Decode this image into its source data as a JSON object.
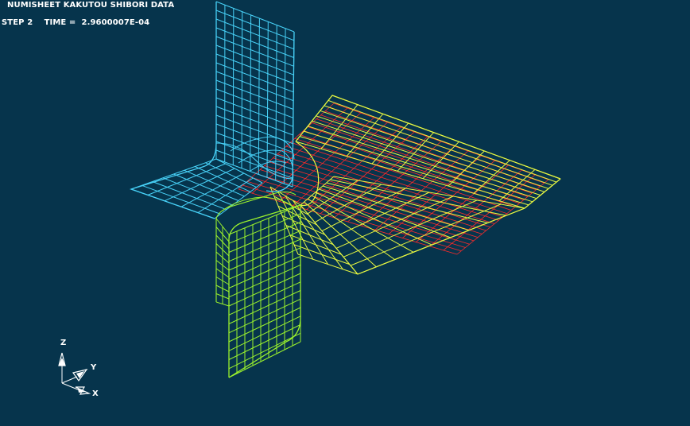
{
  "viewer": {
    "title": "NUMISHEET KAKUTOU SHIBORI DATA",
    "step_label": "STEP",
    "step_value": "2",
    "time_label": "TIME =",
    "time_value": "2.9600007E-04"
  },
  "axis_triad": {
    "z_label": "Z",
    "y_label": "Y",
    "x_label": "X"
  },
  "colors": {
    "background": "#06344c",
    "die_mesh": "#48d2f8",
    "punch_mesh": "#9bf22c",
    "blank_mesh": "#e8f840",
    "blank_inner_mesh": "#ff2a2a",
    "text": "#ffffff"
  },
  "icons": {
    "axis_triad": "xyz-axis-triad-icon"
  }
}
